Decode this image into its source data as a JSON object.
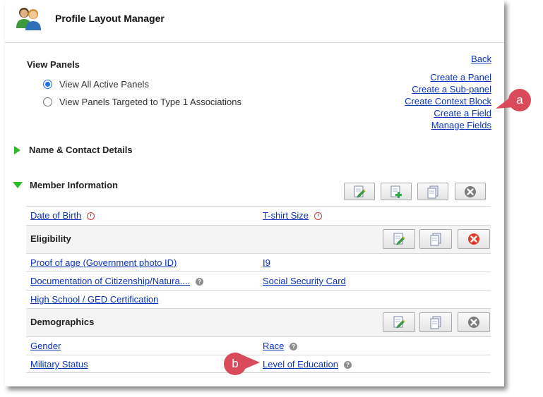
{
  "header": {
    "title": "Profile Layout Manager",
    "icon": "users-icon"
  },
  "view_panels": {
    "title": "View Panels",
    "options": [
      {
        "label": "View All Active Panels",
        "checked": true
      },
      {
        "label": "View Panels Targeted to Type 1 Associations",
        "checked": false
      }
    ]
  },
  "links": {
    "back": "Back",
    "items": [
      "Create a Panel",
      "Create a Sub-panel",
      "Create Context Block",
      "Create a Field",
      "Manage Fields"
    ]
  },
  "sections": {
    "name_contact": "Name & Contact Details",
    "member_info": "Member Information"
  },
  "member_fields": {
    "date_of_birth": "Date of Birth",
    "tshirt_size": "T-shirt Size"
  },
  "eligibility": {
    "title": "Eligibility",
    "proof_of_age": "Proof of age (Government photo ID)",
    "i9": "I9",
    "documentation": "Documentation of Citizenship/Natura....",
    "social_security": "Social Security Card",
    "high_school": "High School / GED Certification"
  },
  "demographics": {
    "title": "Demographics",
    "gender": "Gender",
    "race": "Race",
    "military_status": "Military Status",
    "level_of_education": "Level of Education"
  },
  "callouts": {
    "a": "a",
    "b": "b"
  },
  "colors": {
    "link": "#0a33b8",
    "callout": "#d94a5a",
    "triangle": "#2dbb2d",
    "delete_red": "#e03a2a"
  }
}
